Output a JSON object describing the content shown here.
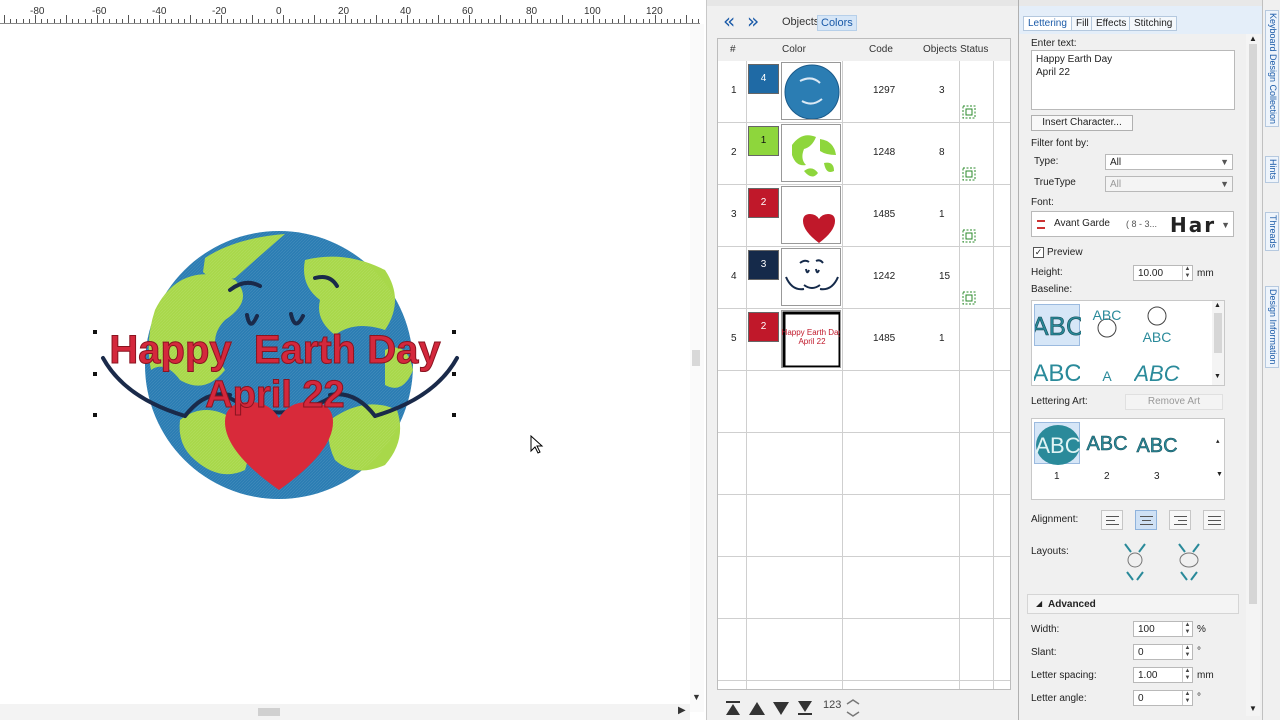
{
  "canvas": {
    "ruler_ticks": [
      "-80",
      "-60",
      "-40",
      "-20",
      "0",
      "20",
      "40",
      "60",
      "80",
      "100",
      "120"
    ]
  },
  "design": {
    "line1": "Happy  Earth Day",
    "line2": "April 22"
  },
  "sequence": {
    "tabs": {
      "objects": "Objects",
      "colors": "Colors"
    },
    "columns": {
      "num": "#",
      "color": "Color",
      "code": "Code",
      "objects": "Objects",
      "status": "Status"
    },
    "rows": [
      {
        "num": "1",
        "chip_label": "4",
        "chip_color": "#1f6aa5",
        "code": "1297",
        "objects": "3",
        "thumb": "globe-blue"
      },
      {
        "num": "2",
        "chip_label": "1",
        "chip_color": "#8ed63c",
        "code": "1248",
        "objects": "8",
        "thumb": "continents-green"
      },
      {
        "num": "3",
        "chip_label": "2",
        "chip_color": "#c0182a",
        "code": "1485",
        "objects": "1",
        "thumb": "heart-red"
      },
      {
        "num": "4",
        "chip_label": "3",
        "chip_color": "#152a4a",
        "code": "1242",
        "objects": "15",
        "thumb": "face-navy"
      },
      {
        "num": "5",
        "chip_label": "2",
        "chip_color": "#c0182a",
        "code": "1485",
        "objects": "1",
        "thumb": "text-red"
      }
    ],
    "bottom_label": "123"
  },
  "props": {
    "tabs": {
      "lettering": "Lettering",
      "fill": "Fill",
      "effects": "Effects",
      "stitching": "Stitching"
    },
    "enter_text_label": "Enter text:",
    "text_line1": "Happy Earth Day",
    "text_line2": "April 22",
    "insert_char": "Insert Character...",
    "filter_label": "Filter font by:",
    "type_label": "Type:",
    "type_value": "All",
    "truetype_label": "TrueType",
    "truetype_value": "All",
    "font_label": "Font:",
    "font_name": "Avant Garde",
    "font_sizes": "( 8 - 3...",
    "font_preview": "Har",
    "preview_label": "Preview",
    "height_label": "Height:",
    "height_value": "10.00",
    "height_unit": "mm",
    "baseline_label": "Baseline:",
    "lettering_art_label": "Lettering Art:",
    "remove_art": "Remove Art",
    "art_items": [
      "1",
      "2",
      "3"
    ],
    "alignment_label": "Alignment:",
    "layouts_label": "Layouts:",
    "advanced_label": "Advanced",
    "width_label": "Width:",
    "width_value": "100",
    "width_unit": "%",
    "slant_label": "Slant:",
    "slant_value": "0",
    "slant_unit": "°",
    "spacing_label": "Letter spacing:",
    "spacing_value": "1.00",
    "spacing_unit": "mm",
    "angle_label": "Letter angle:",
    "angle_value": "0",
    "angle_unit": "°"
  },
  "side_tabs": {
    "collection": "Keyboard Design Collection",
    "hints": "Hints",
    "threads": "Threads",
    "info": "Design Information"
  }
}
